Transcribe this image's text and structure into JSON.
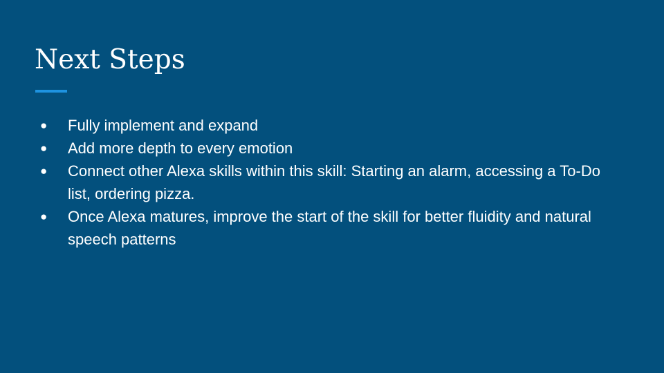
{
  "slide": {
    "title": "Next Steps",
    "accent_color": "#1e93e0",
    "background_color": "#03507d",
    "bullet_glyph": "●",
    "bullets": [
      "Fully implement and expand",
      "Add more depth to every emotion",
      "Connect other Alexa skills within this skill: Starting an alarm, accessing a To-Do list,  ordering pizza.",
      "Once Alexa matures, improve the start of the skill for better fluidity and natural speech patterns"
    ]
  }
}
